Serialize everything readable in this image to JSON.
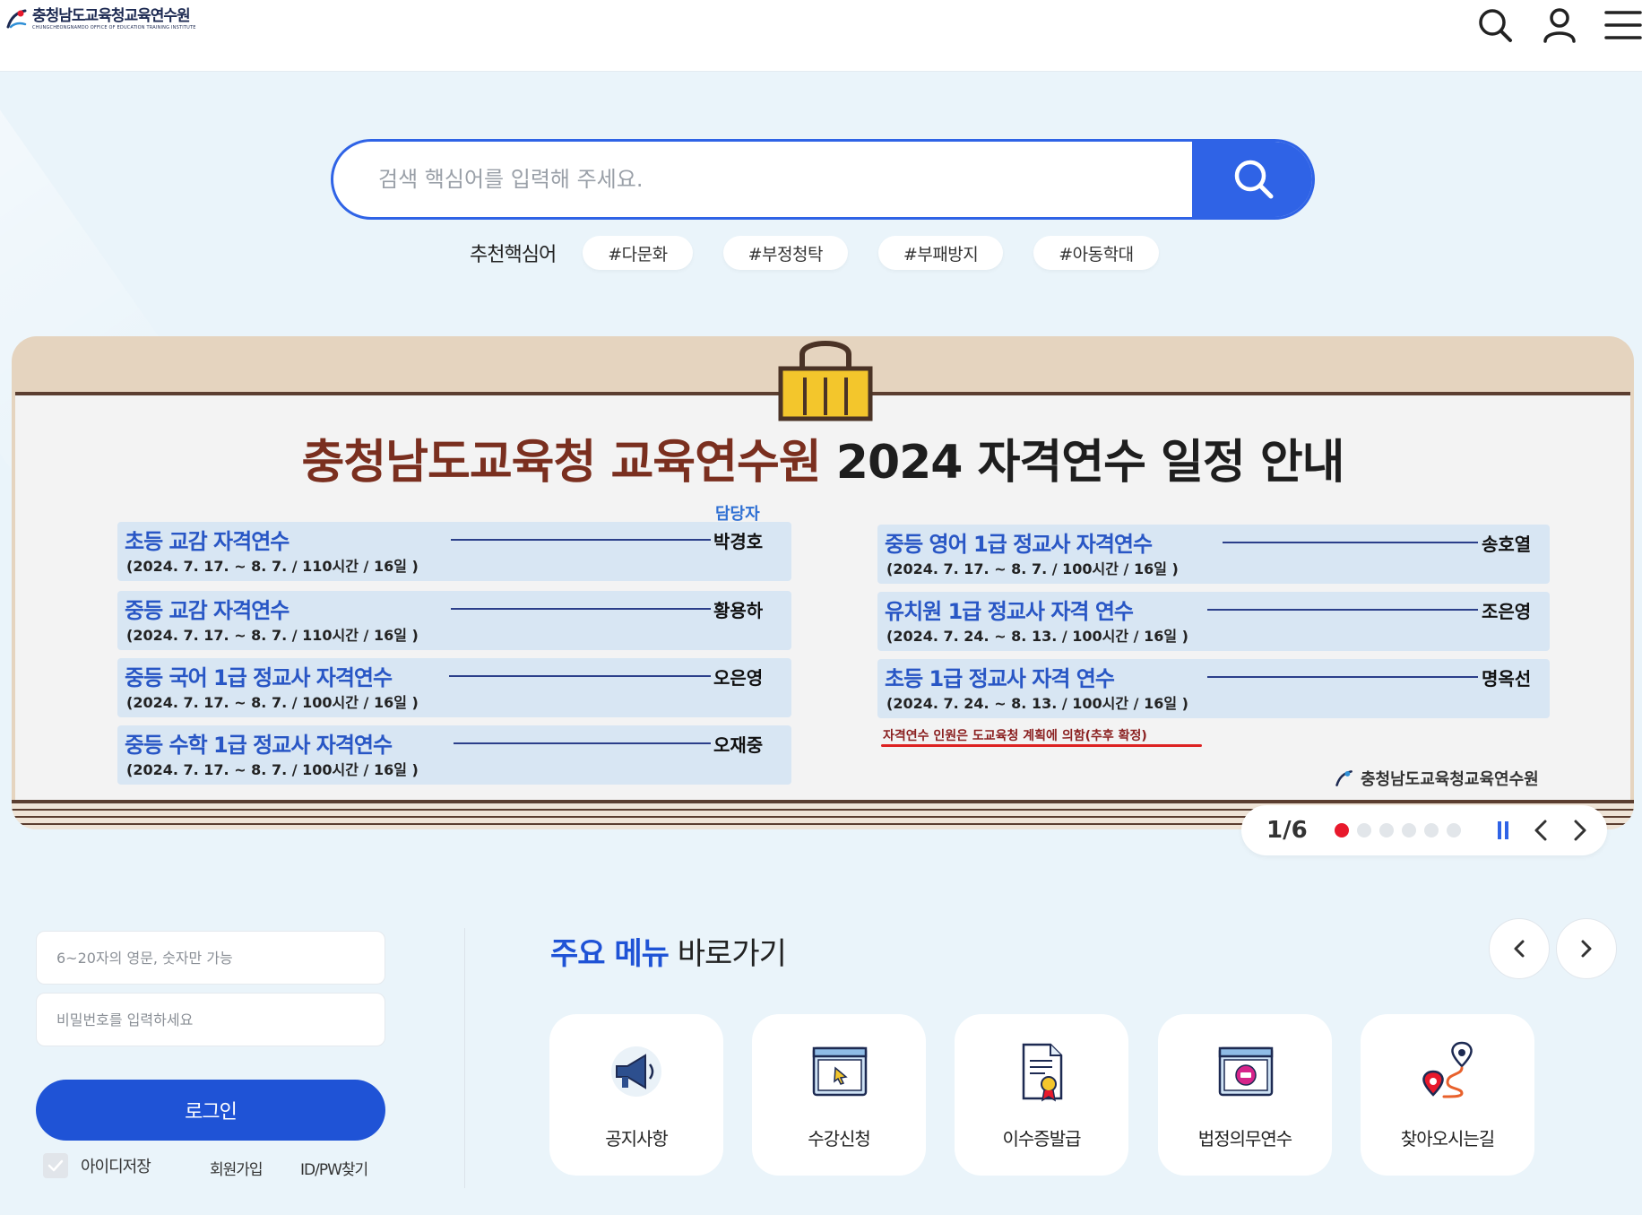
{
  "header": {
    "logo_text": "충청남도교육청교육연수원",
    "logo_sub": "CHUNGCHEONGNAMDO OFFICE OF EDUCATION TRAINING INSTITUTE"
  },
  "search": {
    "placeholder": "검색 핵심어를 입력해 주세요.",
    "keywords_label": "추천핵심어",
    "keywords": [
      "#다문화",
      "#부정청탁",
      "#부패방지",
      "#아동학대"
    ]
  },
  "banner": {
    "title_part1": "충청남도교육청 교육연수원",
    "title_part2": "2024 자격연수 일정 안내",
    "manager_header": "담당자",
    "courses": [
      {
        "name": "초등 교감 자격연수",
        "dates": "(2024. 7. 17. ~ 8. 7. / 110시간 / 16일 )",
        "manager": "박경호"
      },
      {
        "name": "중등 교감 자격연수",
        "dates": "(2024. 7. 17. ~ 8. 7. / 110시간 / 16일 )",
        "manager": "황용하"
      },
      {
        "name": "중등 국어 1급 정교사 자격연수",
        "dates": "(2024. 7. 17. ~ 8. 7. / 100시간 / 16일 )",
        "manager": "오은영"
      },
      {
        "name": "중등 수학 1급 정교사 자격연수",
        "dates": "(2024. 7. 17. ~ 8. 7. / 100시간 / 16일 )",
        "manager": "오재중"
      },
      {
        "name": "중등 영어 1급 정교사 자격연수",
        "dates": "(2024. 7. 17. ~ 8. 7. / 100시간 / 16일 )",
        "manager": "송호열"
      },
      {
        "name": "유치원 1급 정교사 자격 연수",
        "dates": "(2024. 7. 24. ~ 8. 13. / 100시간 / 16일 )",
        "manager": "조은영"
      },
      {
        "name": "초등 1급 정교사 자격 연수",
        "dates": "(2024. 7. 24. ~ 8. 13. / 100시간 / 16일 )",
        "manager": "명옥선"
      }
    ],
    "note": "자격연수 인원은 도교육청 계획에 의함(추후 확정)",
    "org": "충청남도교육청교육연수원"
  },
  "slider": {
    "pager": "1/6",
    "total_slides": 6,
    "current_slide": 1
  },
  "login": {
    "id_placeholder": "6~20자의 영문, 숫자만 가능",
    "pw_placeholder": "비밀번호를 입력하세요",
    "login_label": "로그인",
    "save_id_label": "아이디저장",
    "join_label": "회원가입",
    "find_label": "ID/PW찾기"
  },
  "main_menu": {
    "title_highlight": "주요 메뉴",
    "title_rest": "바로가기",
    "items": [
      {
        "label": "공지사항",
        "icon": "megaphone-icon"
      },
      {
        "label": "수강신청",
        "icon": "cursor-window-icon"
      },
      {
        "label": "이수증발급",
        "icon": "certificate-icon"
      },
      {
        "label": "법정의무연수",
        "icon": "legal-badge-icon"
      },
      {
        "label": "찾아오시는길",
        "icon": "route-pin-icon"
      }
    ]
  },
  "colors": {
    "primary": "#2f63e6",
    "login_button": "#1f53d6",
    "active_dot": "#e8192c",
    "background": "#eaf4fa",
    "banner_title_accent": "#7a2f1f",
    "course_name": "#2856c5"
  }
}
